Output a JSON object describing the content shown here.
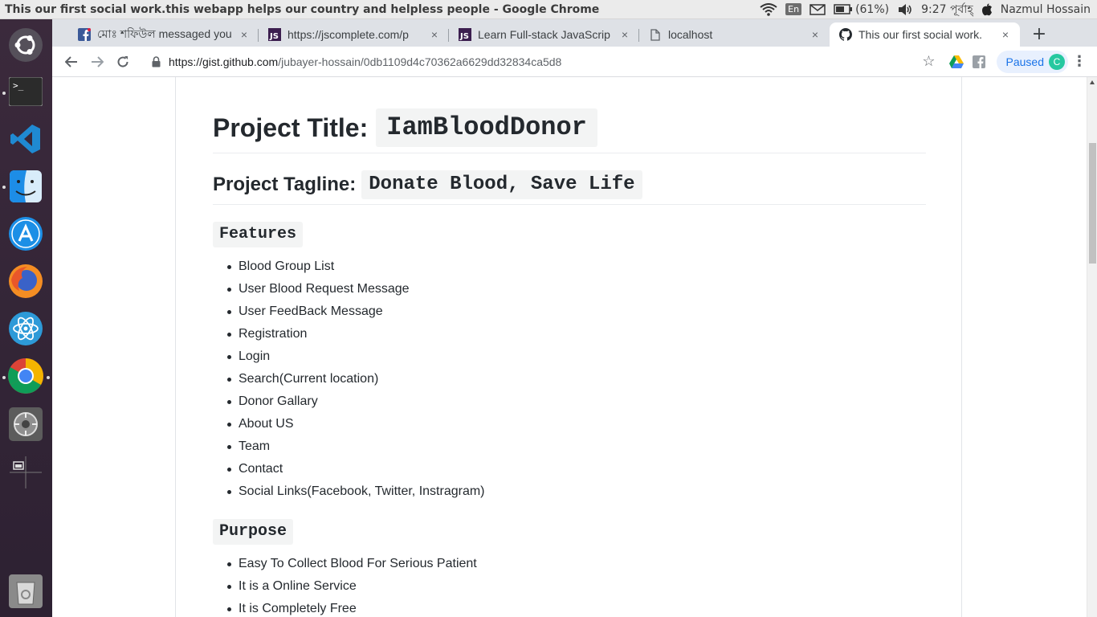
{
  "system_bar": {
    "window_title": "This our first social work.this webapp helps our country and helpless people - Google Chrome",
    "keyboard_layout": "En",
    "battery": "(61%)",
    "clock": "9:27 পূর্বাহ্",
    "user": "Nazmul Hossain",
    "icons": [
      "wifi-icon",
      "mail-icon",
      "battery-icon",
      "volume-icon",
      "apple-icon"
    ]
  },
  "launcher": {
    "items": [
      "ubuntu-dash-icon",
      "terminal-icon",
      "vscode-icon",
      "finder-icon",
      "app-store-icon",
      "firefox-icon",
      "atom-icon",
      "chrome-icon",
      "settings-icon",
      "workspace-switcher-icon",
      "trash-icon"
    ]
  },
  "tabs": [
    {
      "title": "মোঃ শফিউল messaged you",
      "favicon": "facebook-icon",
      "close": "×"
    },
    {
      "title": "https://jscomplete.com/p",
      "favicon": "js-icon",
      "close": "×"
    },
    {
      "title": "Learn Full-stack JavaScrip",
      "favicon": "js-icon",
      "close": "×"
    },
    {
      "title": "localhost",
      "favicon": "page-icon",
      "close": "×"
    },
    {
      "title": "This our first social work.",
      "favicon": "github-icon",
      "close": "×",
      "active": true
    }
  ],
  "new_tab": "+",
  "toolbar": {
    "url_scheme_host": "https://gist.github.com",
    "url_path": "/jubayer-hossain/0db1109d4c70362a6629dd32834ca5d8",
    "profile_label": "Paused",
    "profile_initial": "C"
  },
  "article": {
    "title_label": "Project Title:",
    "title_code": "IamBloodDonor",
    "tagline_label": "Project Tagline:",
    "tagline_code": "Donate Blood, Save Life",
    "features_heading": "Features",
    "features": [
      "Blood Group List",
      "User Blood Request Message",
      "User FeedBack Message",
      "Registration",
      "Login",
      "Search(Current location)",
      "Donor Gallary",
      "About US",
      "Team",
      "Contact",
      "Social Links(Facebook, Twitter, Instragram)"
    ],
    "purpose_heading": "Purpose",
    "purpose": [
      "Easy To Collect Blood For Serious Patient",
      "It is a Online Service",
      "It is Completely Free"
    ]
  }
}
